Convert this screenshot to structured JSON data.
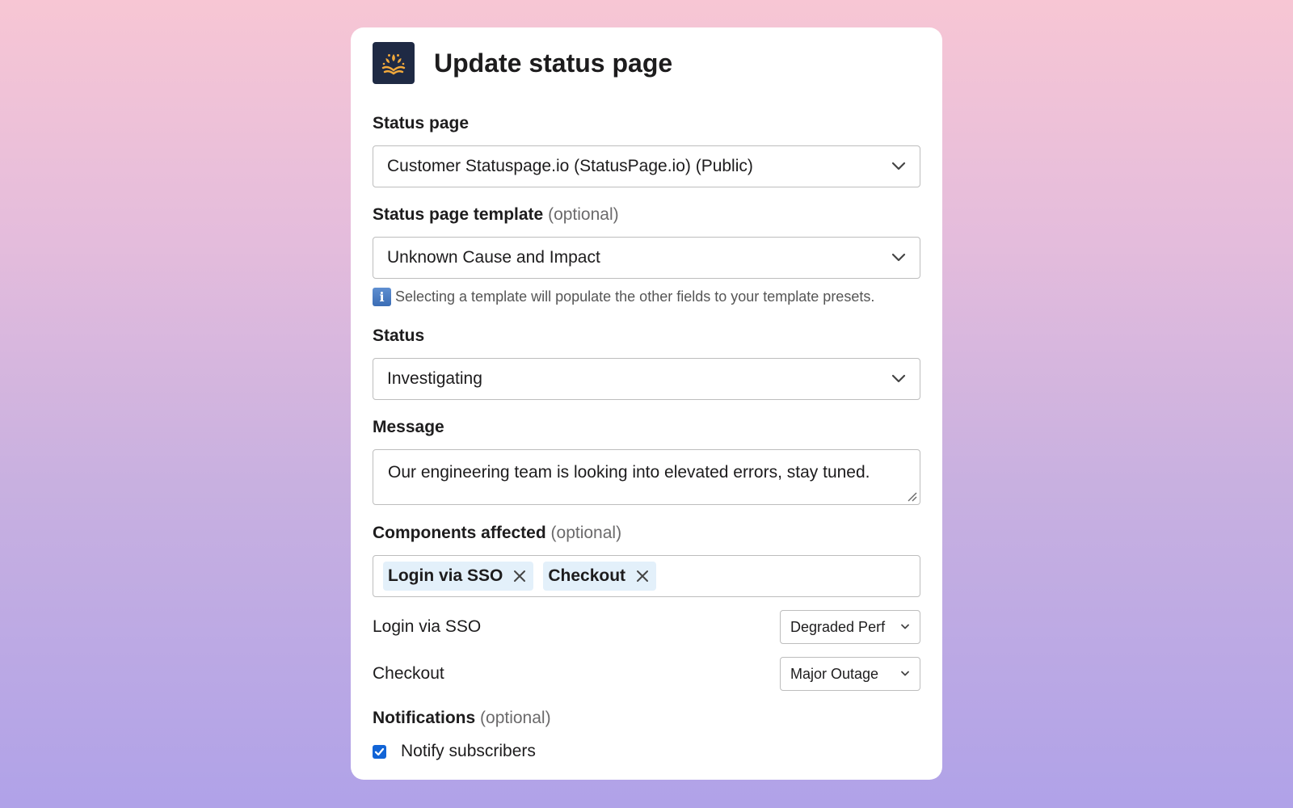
{
  "modal": {
    "title": "Update status page"
  },
  "fields": {
    "status_page": {
      "label": "Status page",
      "value": "Customer Statuspage.io (StatusPage.io) (Public)"
    },
    "template": {
      "label": "Status page template",
      "optional": "(optional)",
      "value": "Unknown Cause and Impact",
      "hint": "Selecting a template will populate the other fields to your template presets."
    },
    "status": {
      "label": "Status",
      "value": "Investigating"
    },
    "message": {
      "label": "Message",
      "value": "Our engineering team is looking into elevated errors, stay tuned."
    },
    "components": {
      "label": "Components affected",
      "optional": "(optional)",
      "chips": [
        "Login via SSO",
        "Checkout"
      ],
      "rows": [
        {
          "name": "Login via SSO",
          "status": "Degraded Perf"
        },
        {
          "name": "Checkout",
          "status": "Major Outage"
        }
      ]
    },
    "notifications": {
      "label": "Notifications",
      "optional": "(optional)",
      "checkbox_label": "Notify subscribers",
      "checked": true
    }
  },
  "icons": {
    "logo": "statuspage-logo-icon",
    "chevron": "chevron-down-icon",
    "info": "info-icon",
    "remove": "close-icon",
    "check": "checkmark-icon"
  },
  "colors": {
    "logo_bg": "#1f2a44",
    "logo_accent": "#f2a93b",
    "chip_bg": "#e3f0fa",
    "checkbox": "#1264d6"
  }
}
